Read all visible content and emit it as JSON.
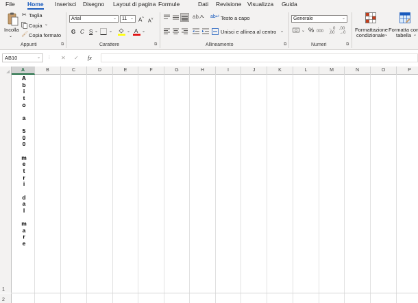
{
  "menu": {
    "tabs": [
      {
        "label": "File",
        "active": false
      },
      {
        "label": "Home",
        "active": true
      },
      {
        "label": "Inserisci",
        "active": false
      },
      {
        "label": "Disegno",
        "active": false
      },
      {
        "label": "Layout di pagina",
        "active": false
      },
      {
        "label": "Formule",
        "active": false
      },
      {
        "label": "Dati",
        "active": false
      },
      {
        "label": "Revisione",
        "active": false
      },
      {
        "label": "Visualizza",
        "active": false
      },
      {
        "label": "Guida",
        "active": false
      }
    ]
  },
  "ribbon": {
    "clipboard": {
      "paste_label": "Incolla",
      "cut_label": "Taglia",
      "copy_label": "Copia",
      "format_painter_label": "Copia formato",
      "group_label": "Appunti"
    },
    "font": {
      "font_name": "Arial",
      "font_size": "11",
      "bold": "G",
      "italic": "C",
      "underline": "S",
      "group_label": "Carattere"
    },
    "alignment": {
      "wrap_text_label": "Testo a capo",
      "merge_label": "Unisci e allinea al centro",
      "group_label": "Allineamento"
    },
    "number": {
      "format": "Generale",
      "percent": "%",
      "thousands": "000",
      "group_label": "Numeri"
    },
    "styles": {
      "conditional_line1": "Formattazione",
      "conditional_line2": "condizionale",
      "table_line1": "Formatta come",
      "table_line2": "tabella"
    }
  },
  "formula_bar": {
    "name_box": "AB10",
    "fx": "fx",
    "content": ""
  },
  "sheet": {
    "columns": [
      "A",
      "B",
      "C",
      "D",
      "E",
      "F",
      "G",
      "H",
      "I",
      "J",
      "K",
      "L",
      "M",
      "N",
      "O",
      "P"
    ],
    "selected_column": "A",
    "rows": [
      "1",
      "2"
    ],
    "cell_a1_text": "Abito a 500 metri dal mare"
  },
  "colors": {
    "accent": "#185abd",
    "excel_green": "#1e6c41",
    "ribbon_bg": "#f3f2f1",
    "gridline": "#e1e1e1"
  }
}
